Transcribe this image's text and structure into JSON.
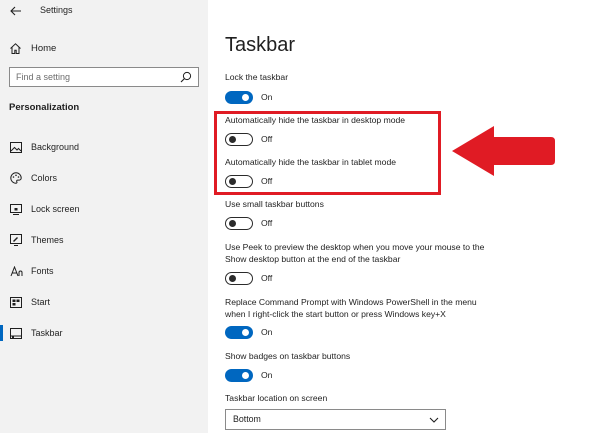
{
  "app": {
    "title": "Settings"
  },
  "sidebar": {
    "home_label": "Home",
    "search_placeholder": "Find a setting",
    "section_title": "Personalization",
    "items": [
      {
        "label": "Background",
        "icon": "picture-icon"
      },
      {
        "label": "Colors",
        "icon": "palette-icon"
      },
      {
        "label": "Lock screen",
        "icon": "monitor-lock-icon"
      },
      {
        "label": "Themes",
        "icon": "brush-icon"
      },
      {
        "label": "Fonts",
        "icon": "font-icon"
      },
      {
        "label": "Start",
        "icon": "start-grid-icon"
      },
      {
        "label": "Taskbar",
        "icon": "taskbar-icon",
        "active": true
      }
    ]
  },
  "main": {
    "title": "Taskbar",
    "settings": [
      {
        "label": "Lock the taskbar",
        "state": "On",
        "on": true
      },
      {
        "label": "Automatically hide the taskbar in desktop mode",
        "state": "Off",
        "on": false
      },
      {
        "label": "Automatically hide the taskbar in tablet mode",
        "state": "Off",
        "on": false
      },
      {
        "label": "Use small taskbar buttons",
        "state": "Off",
        "on": false
      },
      {
        "label_lines": [
          "Use Peek to preview the desktop when you move your mouse to the",
          "Show desktop button at the end of the taskbar"
        ],
        "state": "Off",
        "on": false
      },
      {
        "label_lines": [
          "Replace Command Prompt with Windows PowerShell in the menu",
          "when I right-click the start button or press Windows key+X"
        ],
        "state": "On",
        "on": true
      },
      {
        "label": "Show badges on taskbar buttons",
        "state": "On",
        "on": true
      }
    ],
    "location": {
      "label": "Taskbar location on screen",
      "value": "Bottom"
    }
  },
  "colors": {
    "accent": "#0067c0",
    "highlight": "#e01b24",
    "sidebar_bg": "#f2f2f2"
  }
}
